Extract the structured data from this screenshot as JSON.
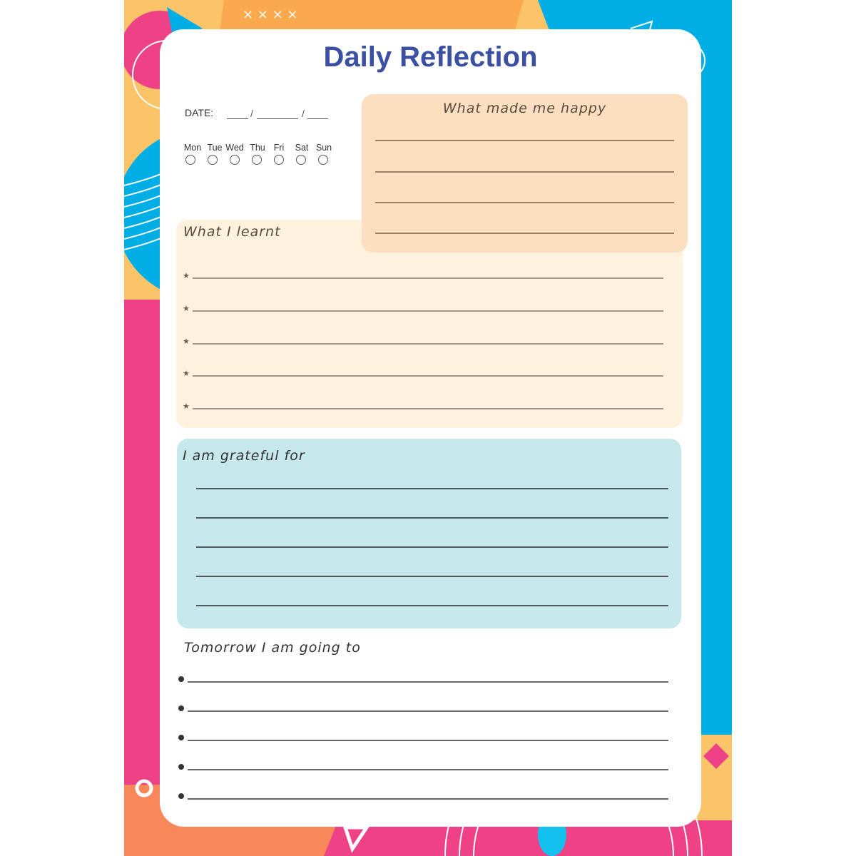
{
  "title": "Daily Reflection",
  "date": {
    "label": "DATE:",
    "separator": "/"
  },
  "weekdays": [
    "Mon",
    "Tue",
    "Wed",
    "Thu",
    "Fri",
    "Sat",
    "Sun"
  ],
  "sections": {
    "happy": {
      "heading": "What made me happy",
      "line_count": 4
    },
    "learnt": {
      "heading": "What I learnt",
      "bullet_icon": "star-icon",
      "line_count": 5
    },
    "grateful": {
      "heading": "I am grateful for",
      "line_count": 5
    },
    "tomorrow": {
      "heading": "Tomorrow I am going to",
      "bullet_icon": "dot-icon",
      "line_count": 5
    }
  },
  "colors": {
    "title": "#3b4fa3",
    "happy_box": "#fcdfc0",
    "learnt_box": "#fef1de",
    "grateful_box": "#c6e7eb",
    "bg_pink": "#ee4186",
    "bg_blue": "#00aee6",
    "bg_yellow": "#fcc468",
    "bg_orange": "#fba94e"
  }
}
